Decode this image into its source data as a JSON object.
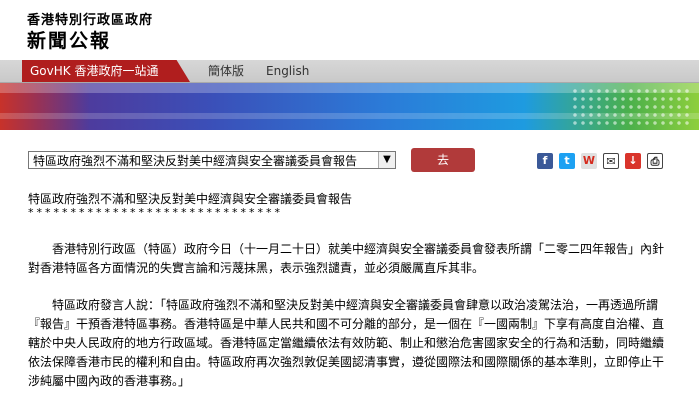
{
  "header": {
    "gov_name": "香港特別行政區政府",
    "press_title": "新聞公報"
  },
  "nav": {
    "govhk": "GovHK 香港政府一站通",
    "simplified": "簡体版",
    "english": "English"
  },
  "toolbar": {
    "selected_release": "特區政府強烈不滿和堅決反對美中經濟與安全審議委員會報告",
    "go_label": "去",
    "share_icons": [
      "facebook-icon",
      "twitter-icon",
      "weibo-icon",
      "email-icon",
      "download-icon",
      "print-icon"
    ]
  },
  "article": {
    "title": "特區政府強烈不滿和堅決反對美中經濟與安全審議委員會報告",
    "stars": "******************************",
    "para1": "　　香港特別行政區（特區）政府今日（十一月二十日）就美中經濟與安全審議委員會發表所謂「二零二四年報告」內針對香港特區各方面情況的失實言論和污蔑抹黑，表示強烈譴責，並必須嚴厲直斥其非。",
    "para2": "　　特區政府發言人說：「特區政府強烈不滿和堅決反對美中經濟與安全審議委員會肆意以政治凌駕法治，一再透過所謂『報告』干預香港特區事務。香港特區是中華人民共和國不可分離的部分，是一個在『一國兩制』下享有高度自治權、直轄於中央人民政府的地方行政區域。香港特區定當繼續依法有效防範、制止和懲治危害國家安全的行為和活動，同時繼續依法保障香港市民的權利和自由。特區政府再次強烈敦促美國認清事實，遵從國際法和國際關係的基本準則，立即停止干涉純屬中國內政的香港事務。」"
  },
  "colors": {
    "nav_red": "#b01e1e",
    "go_button": "#b13a3a"
  }
}
